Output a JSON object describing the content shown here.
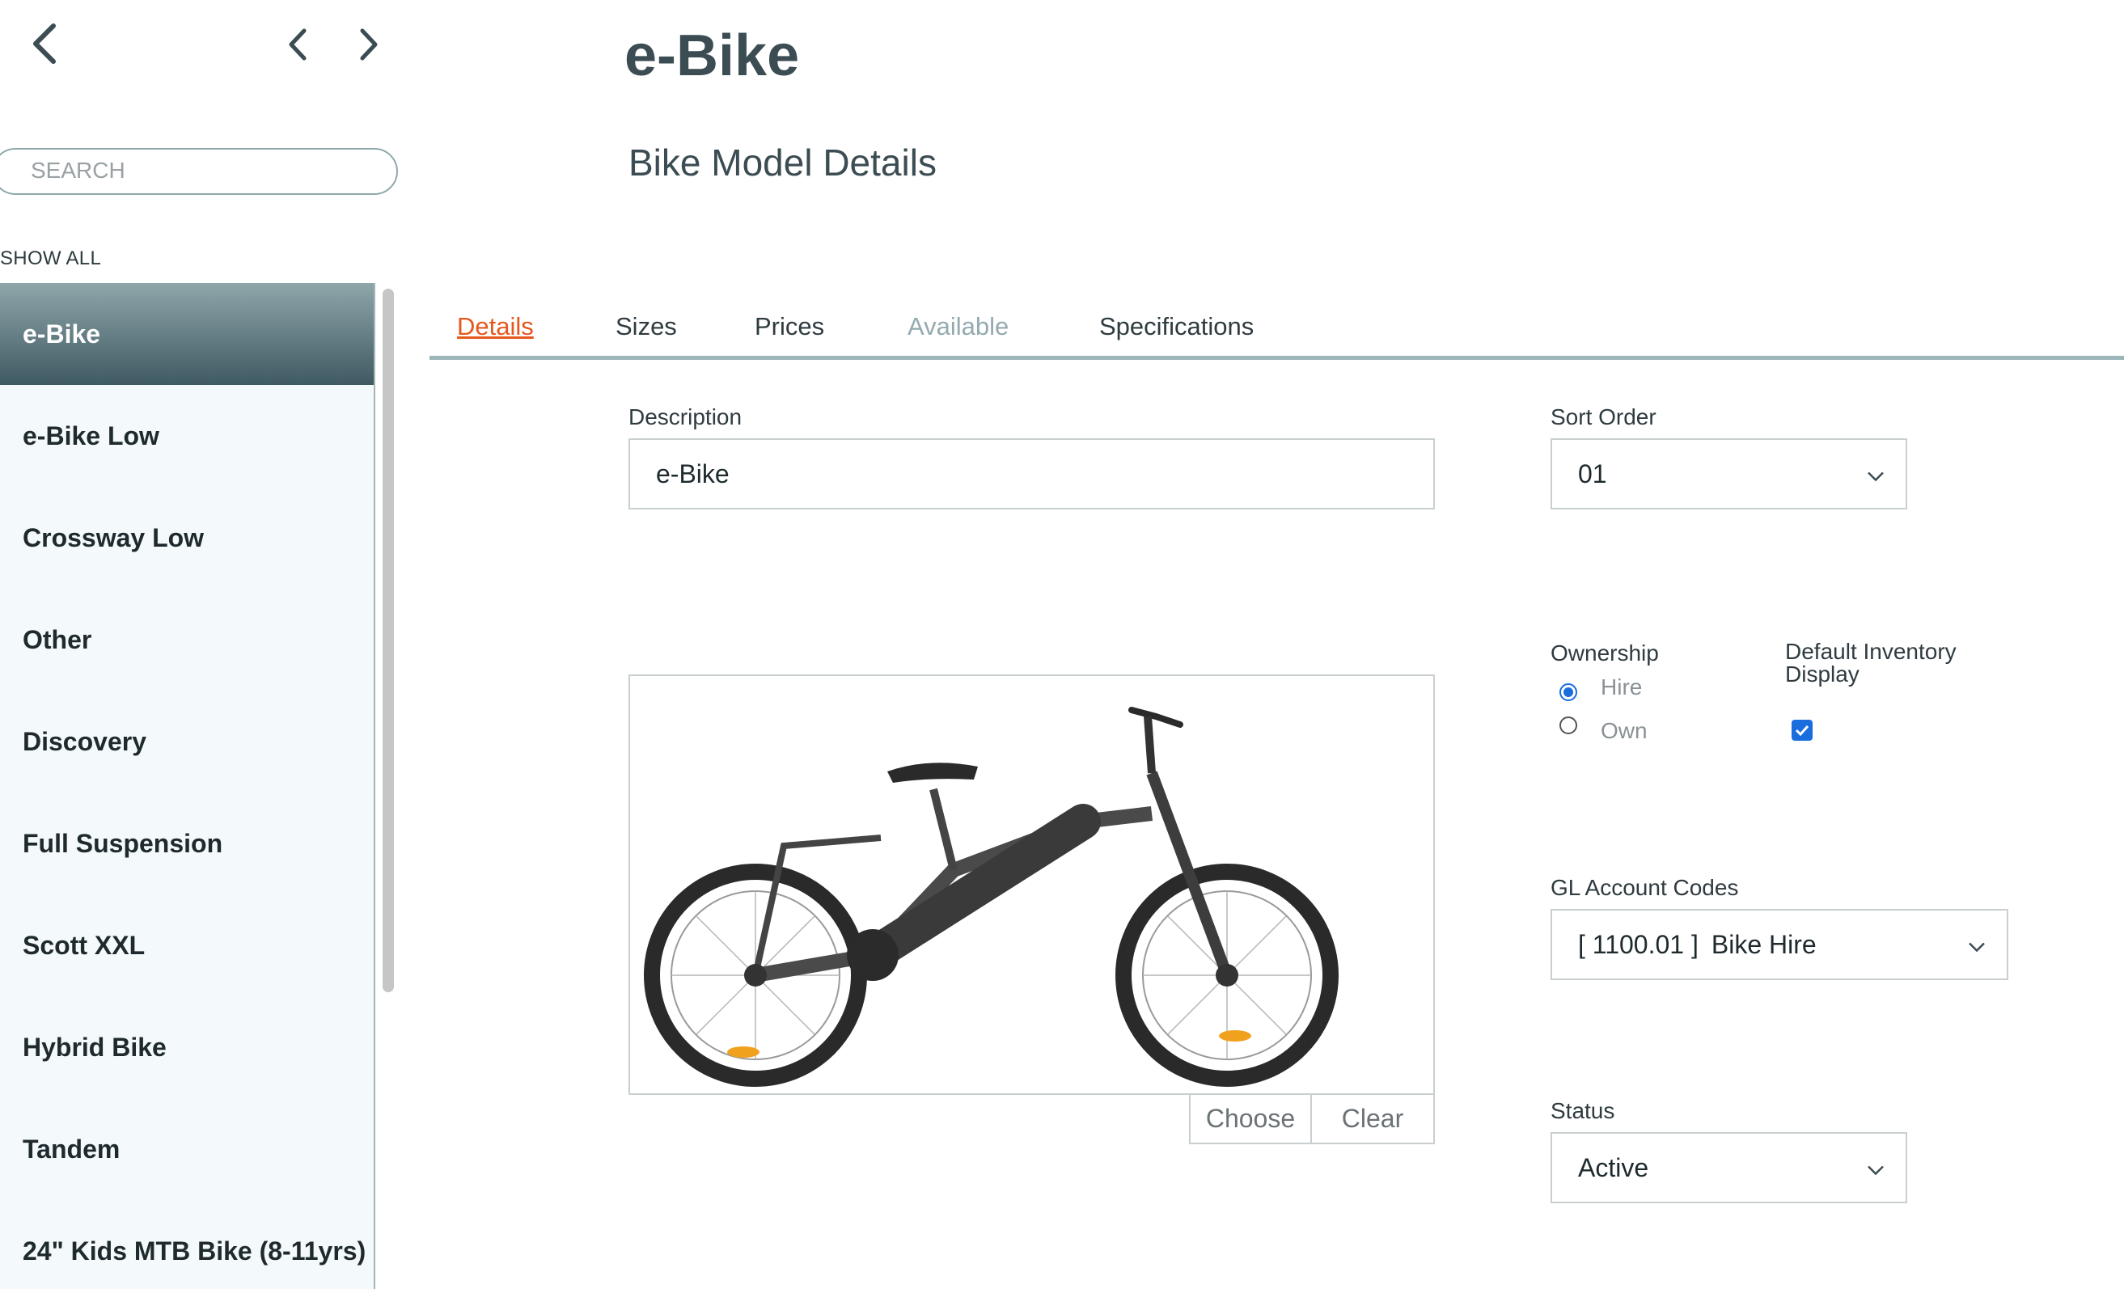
{
  "nav": {
    "back_icon": "chevron-left-icon",
    "prev_icon": "chevron-left-icon",
    "next_icon": "chevron-right-icon"
  },
  "search": {
    "placeholder": "SEARCH",
    "value": ""
  },
  "sidebar": {
    "show_all": "SHOW ALL",
    "items": [
      {
        "label": "e-Bike",
        "active": true
      },
      {
        "label": "e-Bike Low"
      },
      {
        "label": "Crossway Low"
      },
      {
        "label": "Other"
      },
      {
        "label": "Discovery"
      },
      {
        "label": "Full Suspension"
      },
      {
        "label": "Scott XXL"
      },
      {
        "label": "Hybrid Bike"
      },
      {
        "label": "Tandem"
      },
      {
        "label": "24\" Kids MTB Bike (8-11yrs)"
      }
    ]
  },
  "header": {
    "title": "e-Bike",
    "subtitle": "Bike Model Details"
  },
  "tabs": [
    {
      "label": "Details",
      "state": "active"
    },
    {
      "label": "Sizes"
    },
    {
      "label": "Prices"
    },
    {
      "label": "Available",
      "state": "disabled"
    },
    {
      "label": "Specifications"
    }
  ],
  "form": {
    "description": {
      "label": "Description",
      "value": "e-Bike"
    },
    "sort_order": {
      "label": "Sort Order",
      "value": "01"
    },
    "image": {
      "choose_label": "Choose",
      "clear_label": "Clear"
    },
    "ownership": {
      "label": "Ownership",
      "options": [
        {
          "label": "Hire",
          "checked": true
        },
        {
          "label": "Own",
          "checked": false
        }
      ]
    },
    "default_inventory": {
      "label_line1": "Default Inventory",
      "label_line2": "Display",
      "checked": true
    },
    "gl_account": {
      "label": "GL Account Codes",
      "code": "[ 1100.01 ]",
      "name": "Bike Hire"
    },
    "status": {
      "label": "Status",
      "value": "Active"
    }
  },
  "colors": {
    "accent": "#e5581e",
    "sidebar_active": "#4a636b",
    "checkbox": "#1a6ddd"
  }
}
